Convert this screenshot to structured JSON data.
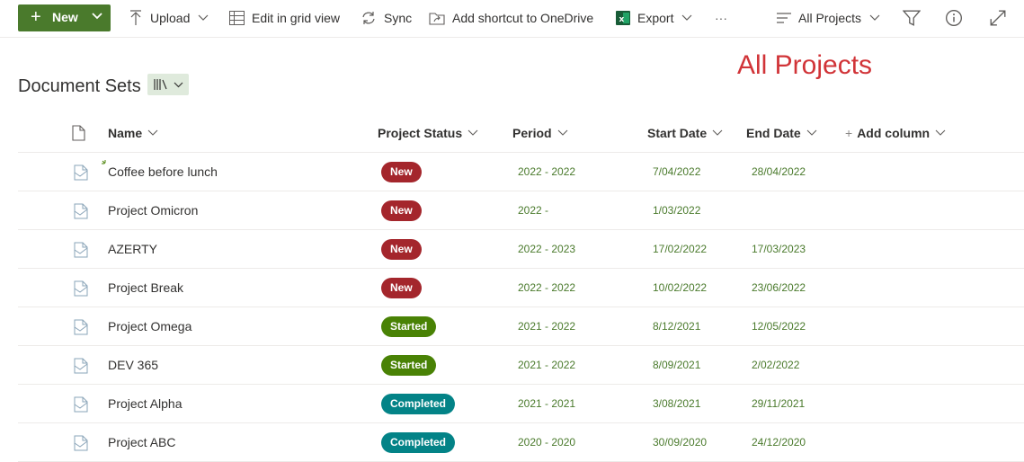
{
  "toolbar": {
    "new_label": "New",
    "upload_label": "Upload",
    "grid_label": "Edit in grid view",
    "sync_label": "Sync",
    "shortcut_label": "Add shortcut to OneDrive",
    "export_label": "Export",
    "more_label": "···",
    "view_label": "All Projects"
  },
  "view_title": "All Projects",
  "page": {
    "title": "Document Sets"
  },
  "columns": {
    "name": "Name",
    "status": "Project Status",
    "period": "Period",
    "start": "Start Date",
    "end": "End Date",
    "add": "Add column"
  },
  "rows": [
    {
      "name": "Coffee before lunch",
      "status": "New",
      "period": "2022 - 2022",
      "start": "7/04/2022",
      "end": "28/04/2022"
    },
    {
      "name": "Project Omicron",
      "status": "New",
      "period": "2022 -",
      "start": "1/03/2022",
      "end": ""
    },
    {
      "name": "AZERTY",
      "status": "New",
      "period": "2022 - 2023",
      "start": "17/02/2022",
      "end": "17/03/2023"
    },
    {
      "name": "Project Break",
      "status": "New",
      "period": "2022 - 2022",
      "start": "10/02/2022",
      "end": "23/06/2022"
    },
    {
      "name": "Project Omega",
      "status": "Started",
      "period": "2021 - 2022",
      "start": "8/12/2021",
      "end": "12/05/2022"
    },
    {
      "name": "DEV 365",
      "status": "Started",
      "period": "2021 - 2022",
      "start": "8/09/2021",
      "end": "2/02/2022"
    },
    {
      "name": "Project Alpha",
      "status": "Completed",
      "period": "2021 - 2021",
      "start": "3/08/2021",
      "end": "29/11/2021"
    },
    {
      "name": "Project ABC",
      "status": "Completed",
      "period": "2020 - 2020",
      "start": "30/09/2020",
      "end": "24/12/2020"
    }
  ],
  "colors": {
    "accent": "#4a7a2c",
    "status_new": "#a4262c",
    "status_started": "#498205",
    "status_completed": "#038387",
    "title_red": "#d13438"
  }
}
